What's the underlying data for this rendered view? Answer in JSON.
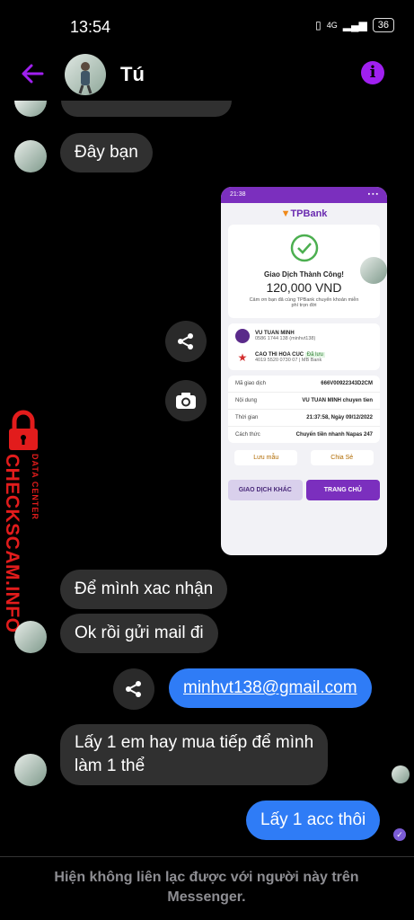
{
  "status": {
    "time": "13:54",
    "signal": "4G",
    "battery": "36"
  },
  "header": {
    "contact_name": "Tú"
  },
  "messages": [
    {
      "id": "m1",
      "text": "Đây bạn"
    },
    {
      "id": "m2",
      "text": "Để mình xac nhận"
    },
    {
      "id": "m3",
      "text": "Ok rồi gửi mail đi"
    },
    {
      "id": "m4",
      "text": "minhvt138@gmail.com",
      "mine": true
    },
    {
      "id": "m5_line1",
      "text": "Lấy 1 em hay mua tiếp để mình"
    },
    {
      "id": "m5_line2",
      "text": "làm 1 thể"
    },
    {
      "id": "m6",
      "text": "Lấy 1 acc thôi",
      "mine": true
    }
  ],
  "shot": {
    "status_time": "21:38",
    "brand": "TPBank",
    "success": "Giao Dịch Thành Công!",
    "amount": "120,000 VND",
    "thanks": "Cảm ơn bạn đã cùng TPBank chuyển khoản miễn phí trọn đời",
    "sender_name": "VU TUAN MINH",
    "sender_acct": "0586 1744 138 (minhvt138)",
    "receiver_name": "CAO THI HOA CUC",
    "receiver_badge": "Đã lưu",
    "receiver_acct": "4019 5520 0730 07",
    "receiver_bank": "MB Bank",
    "rows": [
      {
        "label": "Mã giao dịch",
        "value": "666V00922343D2CM"
      },
      {
        "label": "Nội dung",
        "value": "VU TUAN MINH chuyen tien"
      },
      {
        "label": "Thời gian",
        "value": "21:37:58, Ngày 09/12/2022"
      },
      {
        "label": "Cách thức",
        "value": "Chuyển tiền nhanh Napas 247"
      }
    ],
    "save_label": "Lưu mẫu",
    "share_label": "Chia Sẻ",
    "other_btn": "GIAO DỊCH KHÁC",
    "home_btn": "TRANG CHỦ"
  },
  "watermark": {
    "main": "CHECKSCAM.INFO",
    "sub": "DATA CENTER"
  },
  "footer": {
    "line1": "Hiện không liên lạc được với người này trên",
    "line2": "Messenger."
  },
  "colors": {
    "accent": "#a020f0",
    "my_bubble": "#2f7cf6",
    "their_bubble": "#303030",
    "watermark": "#e21c1c"
  },
  "icons": [
    "back-arrow-icon",
    "info-icon",
    "share-icon",
    "camera-icon",
    "check-icon",
    "seen-avatar-icon"
  ]
}
